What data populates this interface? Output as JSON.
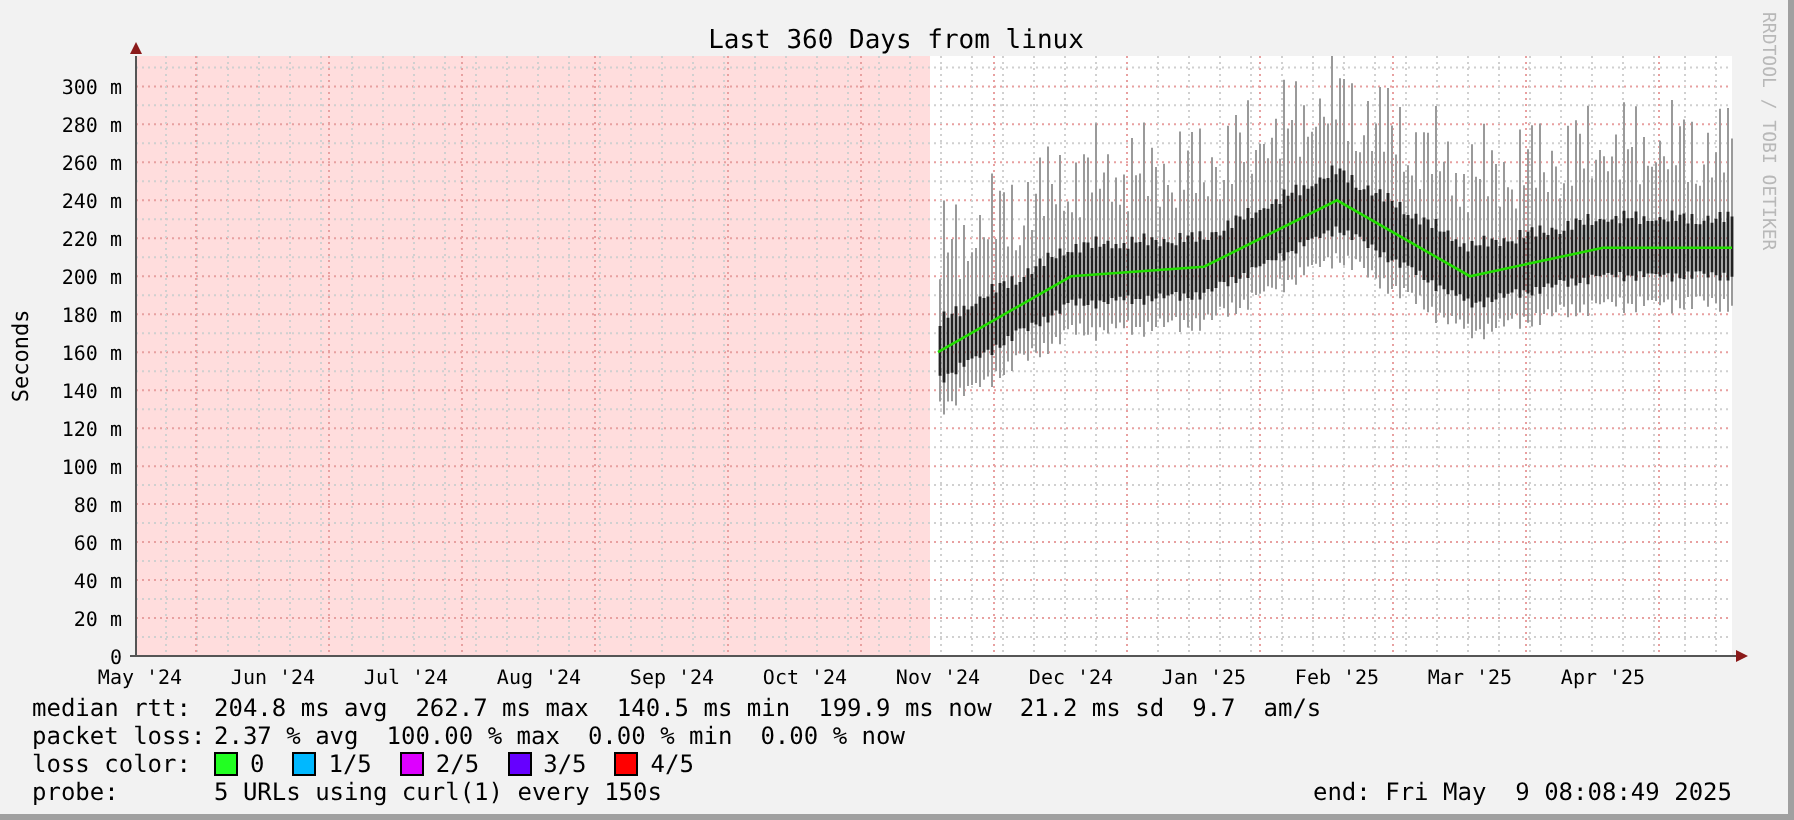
{
  "graph": {
    "watermark": "RRDTOOL / TOBI OETIKER",
    "chart_data": {
      "type": "line",
      "title": "Last 360 Days from linux",
      "ylabel": "Seconds",
      "ylim": [
        0,
        316
      ],
      "grid": true,
      "categories": [
        "May '24",
        "Jun '24",
        "Jul '24",
        "Aug '24",
        "Sep '24",
        "Oct '24",
        "Nov '24",
        "Dec '24",
        "Jan '25",
        "Feb '25",
        "Mar '25",
        "Apr '25"
      ],
      "yticks": [
        {
          "value": 0,
          "label": "0"
        },
        {
          "value": 20,
          "label": "20 m"
        },
        {
          "value": 40,
          "label": "40 m"
        },
        {
          "value": 60,
          "label": "60 m"
        },
        {
          "value": 80,
          "label": "80 m"
        },
        {
          "value": 100,
          "label": "100 m"
        },
        {
          "value": 120,
          "label": "120 m"
        },
        {
          "value": 140,
          "label": "140 m"
        },
        {
          "value": 160,
          "label": "160 m"
        },
        {
          "value": 180,
          "label": "180 m"
        },
        {
          "value": 200,
          "label": "200 m"
        },
        {
          "value": 220,
          "label": "220 m"
        },
        {
          "value": 240,
          "label": "240 m"
        },
        {
          "value": 260,
          "label": "260 m"
        },
        {
          "value": 280,
          "label": "280 m"
        },
        {
          "value": 300,
          "label": "300 m"
        }
      ],
      "series": [
        {
          "color": "#22dd00",
          "values": [
            null,
            null,
            null,
            null,
            null,
            null,
            160,
            200,
            205,
            240,
            200,
            215
          ]
        }
      ]
    }
  },
  "legend": {
    "median_rtt": {
      "label": "median rtt:",
      "values": [
        "204.8 ms avg",
        "262.7 ms max",
        "140.5 ms min",
        "199.9 ms now",
        "21.2 ms sd",
        "9.7",
        "am/s"
      ]
    },
    "packet_loss": {
      "label": "packet loss:",
      "values": [
        "2.37 % avg",
        "100.00 % max",
        "0.00 % min",
        "0.00 % now"
      ]
    },
    "loss_color": {
      "label": "loss color:",
      "items": [
        {
          "label": "0",
          "color": "#22ff22"
        },
        {
          "label": "1/5",
          "color": "#00b8ff"
        },
        {
          "label": "2/5",
          "color": "#dd00ff"
        },
        {
          "label": "3/5",
          "color": "#6600ff"
        },
        {
          "label": "4/5",
          "color": "#ff0000"
        }
      ]
    },
    "probe": {
      "label": "probe:",
      "value": "5 URLs using curl(1) every 150s"
    },
    "end": "end: Fri May  9 08:08:49 2025"
  }
}
